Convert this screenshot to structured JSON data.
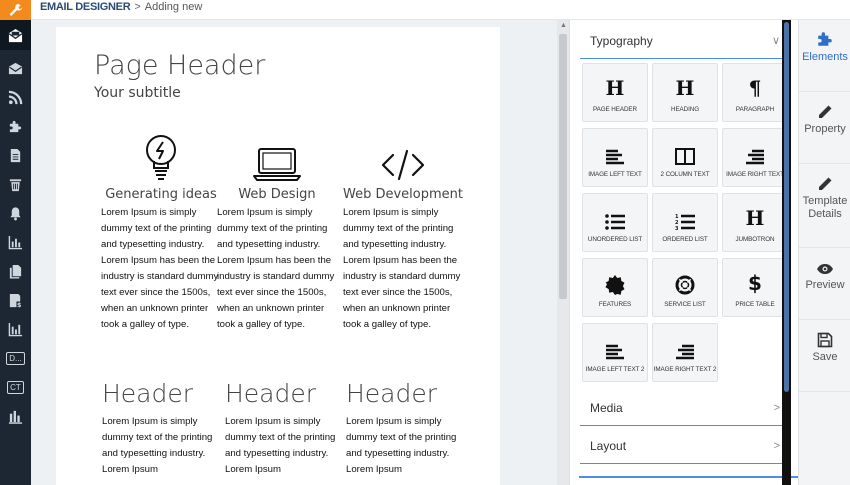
{
  "topbar": {
    "app_name": "EMAIL DESIGNER",
    "separator": ">",
    "current_page": "Adding new"
  },
  "sidebar": {
    "items": [
      {
        "icon": "email-open-icon",
        "active": true
      },
      {
        "icon": "email-icon"
      },
      {
        "icon": "rss-icon"
      },
      {
        "icon": "puzzle-icon"
      },
      {
        "icon": "document-icon"
      },
      {
        "icon": "trash-icon"
      },
      {
        "icon": "bell-icon"
      },
      {
        "icon": "bar-chart-icon"
      },
      {
        "icon": "pages-icon"
      },
      {
        "icon": "report-icon"
      },
      {
        "icon": "bar-chart-icon"
      },
      {
        "icon": "text-badge-icon",
        "text": "D..."
      },
      {
        "icon": "text-badge-icon",
        "text": "CT"
      },
      {
        "icon": "stats-icon"
      }
    ]
  },
  "canvas": {
    "title": "Page Header",
    "subtitle": "Your subtitle",
    "features": [
      {
        "icon": "lightbulb-icon",
        "heading": "Generating ideas",
        "body": "Lorem Ipsum is simply dummy text of the printing and typesetting industry. Lorem Ipsum has been the industry is standard dummy text ever since the 1500s, when an unknown printer took a galley of type."
      },
      {
        "icon": "laptop-icon",
        "heading": "Web Design",
        "body": "Lorem Ipsum is simply dummy text of the printing and typesetting industry. Lorem Ipsum has been the industry is standard dummy text ever since the 1500s, when an unknown printer took a galley of type."
      },
      {
        "icon": "code-icon",
        "heading": "Web Development",
        "body": "Lorem Ipsum is simply dummy text of the printing and typesetting industry. Lorem Ipsum has been the industry is standard dummy text ever since the 1500s, when an unknown printer took a galley of type."
      }
    ],
    "columns": [
      {
        "heading": "Header",
        "body": "Lorem Ipsum is simply dummy text of the printing and typesetting industry. Lorem Ipsum"
      },
      {
        "heading": "Header",
        "body": "Lorem Ipsum is simply dummy text of the printing and typesetting industry. Lorem Ipsum"
      },
      {
        "heading": "Header",
        "body": "Lorem Ipsum is simply dummy text of the printing and typesetting industry. Lorem Ipsum"
      }
    ]
  },
  "panel": {
    "sections": {
      "typography": {
        "label": "Typography",
        "chevron": "∨"
      },
      "media": {
        "label": "Media",
        "chevron": ">"
      },
      "layout": {
        "label": "Layout",
        "chevron": ">"
      }
    },
    "tiles": [
      {
        "label": "PAGE HEADER",
        "icon": "page-header-icon",
        "glyph": "H"
      },
      {
        "label": "HEADING",
        "icon": "heading-icon",
        "glyph": "H"
      },
      {
        "label": "PARAGRAPH",
        "icon": "paragraph-icon",
        "glyph": "¶"
      },
      {
        "label": "IMAGE LEFT TEXT",
        "icon": "align-left-icon"
      },
      {
        "label": "2 COLUMN TEXT",
        "icon": "columns-icon"
      },
      {
        "label": "IMAGE RIGHT TEXT",
        "icon": "align-right-icon"
      },
      {
        "label": "UNORDERED LIST",
        "icon": "unordered-list-icon"
      },
      {
        "label": "ORDERED LIST",
        "icon": "ordered-list-icon"
      },
      {
        "label": "JUMBOTRON",
        "icon": "jumbotron-icon",
        "glyph": "H"
      },
      {
        "label": "FEATURES",
        "icon": "badge-icon"
      },
      {
        "label": "SERVICE LIST",
        "icon": "lifebuoy-icon"
      },
      {
        "label": "PRICE TABLE",
        "icon": "dollar-icon",
        "glyph": "$"
      },
      {
        "label": "IMAGE LEFT TEXT 2",
        "icon": "align-left-icon"
      },
      {
        "label": "IMAGE RIGHT TEXT 2",
        "icon": "align-right-icon"
      }
    ]
  },
  "right_tabs": [
    {
      "label": "Elements",
      "icon": "puzzle-icon",
      "active": true
    },
    {
      "label": "Property",
      "icon": "pencil-icon"
    },
    {
      "label": "Template Details",
      "icon": "pencil-icon"
    },
    {
      "label": "Preview",
      "icon": "eye-icon"
    },
    {
      "label": "Save",
      "icon": "floppy-disk-icon"
    }
  ],
  "colors": {
    "accent": "#2f6fc9",
    "accordion_line": "#4a8ee8",
    "sidebar_bg": "#1d2733",
    "logo_bg": "#f28a1d"
  }
}
